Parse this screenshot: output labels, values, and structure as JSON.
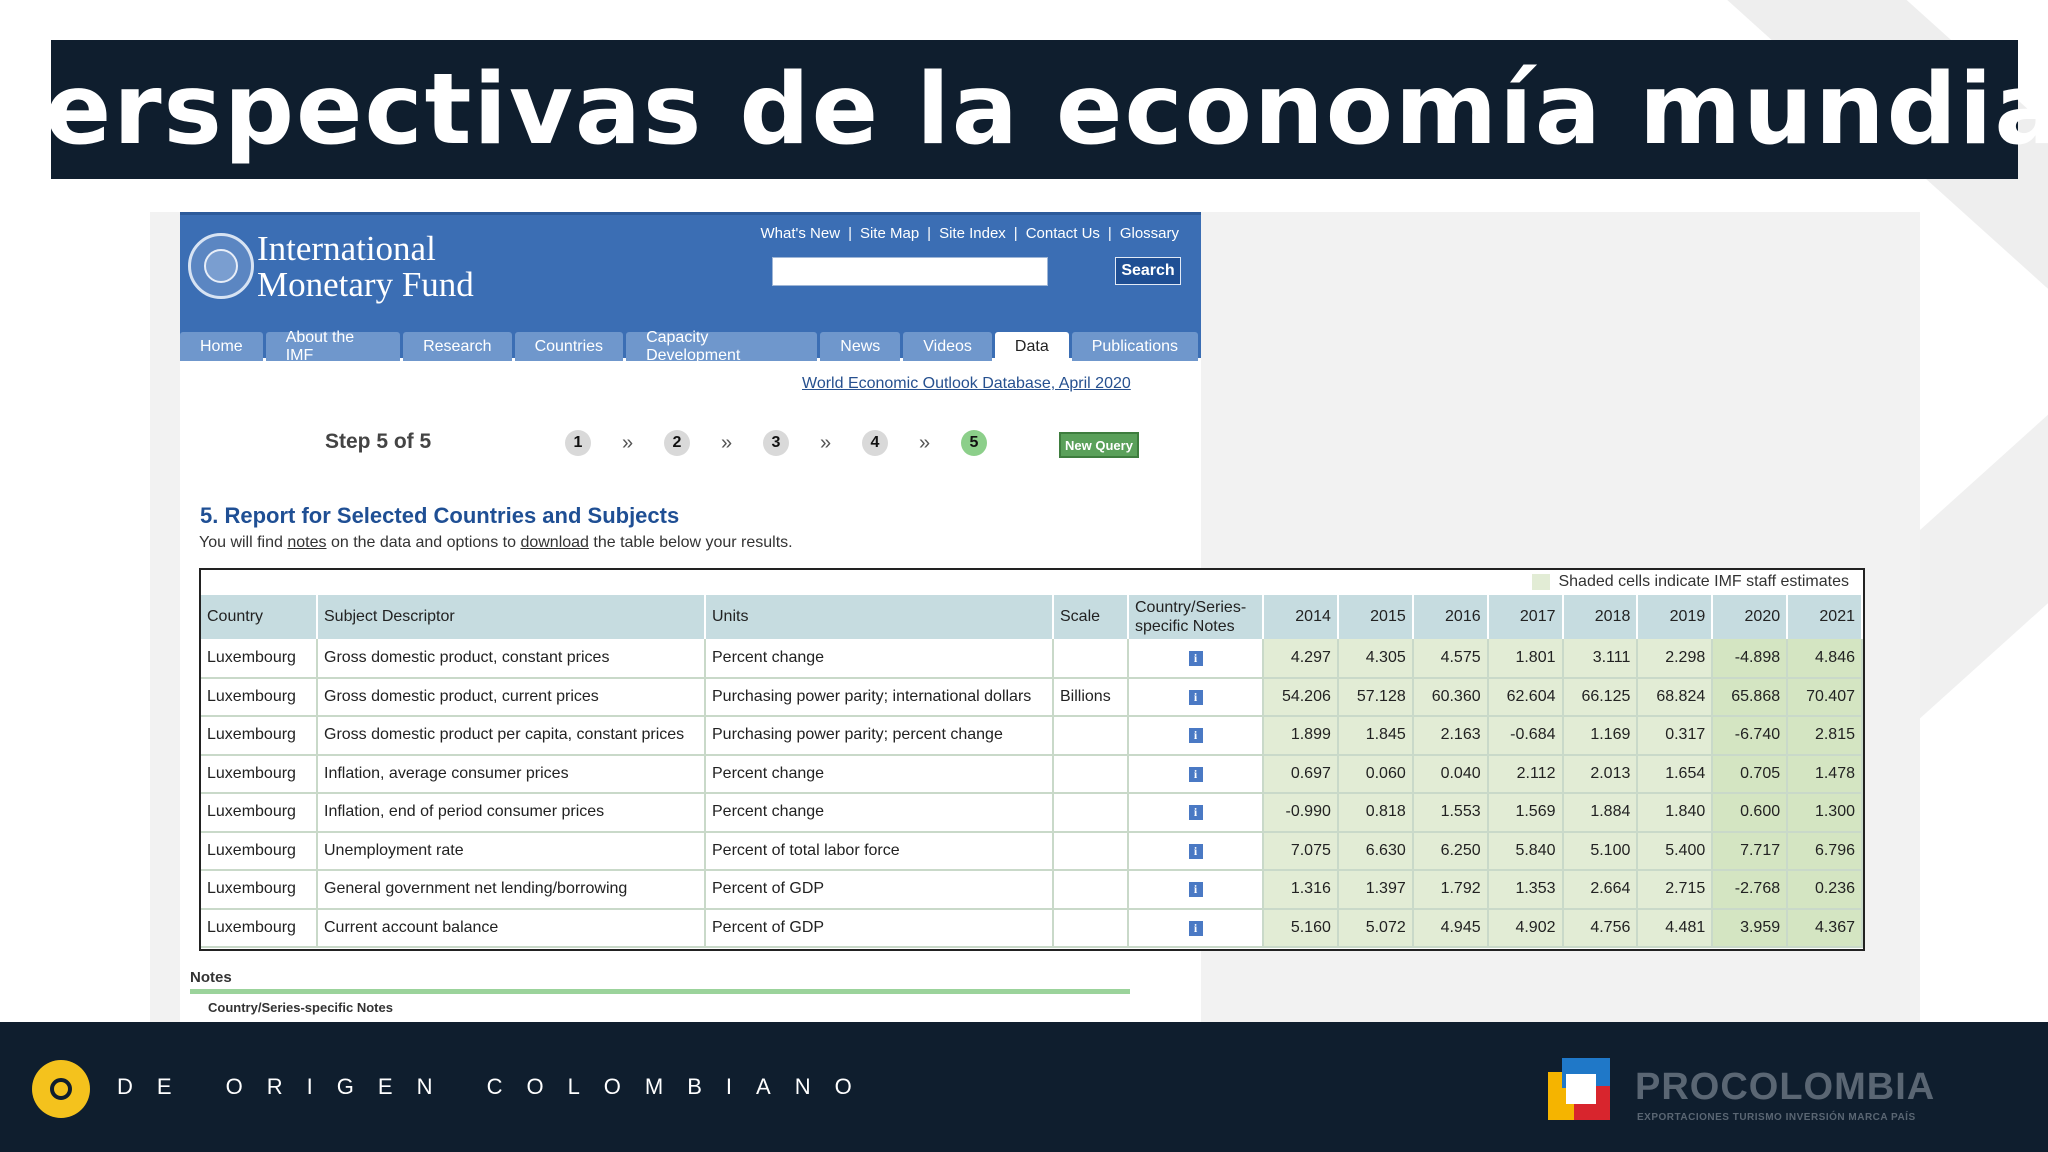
{
  "slide": {
    "title": "Perspectivas de la economía mundial",
    "footer_tagline": "DE ORIGEN COLOMBIANO",
    "brand": {
      "name": "PROCOLOMBIA",
      "subtitle": "EXPORTACIONES TURISMO INVERSIÓN MARCA PAÍS"
    }
  },
  "imf": {
    "logo_text_line1": "International",
    "logo_text_line2": "Monetary Fund",
    "top_links": [
      "What's New",
      "Site Map",
      "Site Index",
      "Contact Us",
      "Glossary"
    ],
    "search": {
      "placeholder": "",
      "button": "Search"
    },
    "tabs": [
      {
        "label": "Home"
      },
      {
        "label": "About the IMF"
      },
      {
        "label": "Research"
      },
      {
        "label": "Countries"
      },
      {
        "label": "Capacity Development"
      },
      {
        "label": "News"
      },
      {
        "label": "Videos"
      },
      {
        "label": "Data",
        "active": true
      },
      {
        "label": "Publications"
      }
    ],
    "database_link": "World Economic Outlook Database, April 2020"
  },
  "wizard": {
    "step_label": "Step 5 of 5",
    "steps": [
      "1",
      "2",
      "3",
      "4",
      "5"
    ],
    "current_step": 5,
    "new_query": "New Query"
  },
  "report": {
    "title": "5. Report for Selected Countries and Subjects",
    "subtitle_pre": "You will find ",
    "subtitle_notes": "notes",
    "subtitle_mid": " on the data and options to ",
    "subtitle_download": "download",
    "subtitle_post": " the table below your results.",
    "shade_note": "Shaded cells indicate IMF staff estimates",
    "columns": {
      "country": "Country",
      "subject": "Subject Descriptor",
      "units": "Units",
      "scale": "Scale",
      "notes": "Country/Series-specific Notes",
      "years": [
        "2014",
        "2015",
        "2016",
        "2017",
        "2018",
        "2019",
        "2020",
        "2021"
      ]
    },
    "rows": [
      {
        "country": "Luxembourg",
        "subject": "Gross domestic product, constant prices",
        "units": "Percent change",
        "scale": "",
        "values": [
          "4.297",
          "4.305",
          "4.575",
          "1.801",
          "3.111",
          "2.298",
          "-4.898",
          "4.846"
        ]
      },
      {
        "country": "Luxembourg",
        "subject": "Gross domestic product, current prices",
        "units": "Purchasing power parity; international dollars",
        "scale": "Billions",
        "values": [
          "54.206",
          "57.128",
          "60.360",
          "62.604",
          "66.125",
          "68.824",
          "65.868",
          "70.407"
        ]
      },
      {
        "country": "Luxembourg",
        "subject": "Gross domestic product per capita, constant prices",
        "units": "Purchasing power parity; percent change",
        "scale": "",
        "values": [
          "1.899",
          "1.845",
          "2.163",
          "-0.684",
          "1.169",
          "0.317",
          "-6.740",
          "2.815"
        ]
      },
      {
        "country": "Luxembourg",
        "subject": "Inflation, average consumer prices",
        "units": "Percent change",
        "scale": "",
        "values": [
          "0.697",
          "0.060",
          "0.040",
          "2.112",
          "2.013",
          "1.654",
          "0.705",
          "1.478"
        ]
      },
      {
        "country": "Luxembourg",
        "subject": "Inflation, end of period consumer prices",
        "units": "Percent change",
        "scale": "",
        "values": [
          "-0.990",
          "0.818",
          "1.553",
          "1.569",
          "1.884",
          "1.840",
          "0.600",
          "1.300"
        ]
      },
      {
        "country": "Luxembourg",
        "subject": "Unemployment rate",
        "units": "Percent of total labor force",
        "scale": "",
        "values": [
          "7.075",
          "6.630",
          "6.250",
          "5.840",
          "5.100",
          "5.400",
          "7.717",
          "6.796"
        ]
      },
      {
        "country": "Luxembourg",
        "subject": "General government net lending/borrowing",
        "units": "Percent of GDP",
        "scale": "",
        "values": [
          "1.316",
          "1.397",
          "1.792",
          "1.353",
          "2.664",
          "2.715",
          "-2.768",
          "0.236"
        ]
      },
      {
        "country": "Luxembourg",
        "subject": "Current account balance",
        "units": "Percent of GDP",
        "scale": "",
        "values": [
          "5.160",
          "5.072",
          "4.945",
          "4.902",
          "4.756",
          "4.481",
          "3.959",
          "4.367"
        ]
      }
    ],
    "notes_label": "Notes",
    "notes_sub": "Country/Series-specific Notes"
  },
  "colors": {
    "title_band": "#0f1e2e",
    "imf_blue": "#3b6eb4",
    "estimate_shade": "#e2ecd5",
    "header_row": "#c6dce0"
  }
}
